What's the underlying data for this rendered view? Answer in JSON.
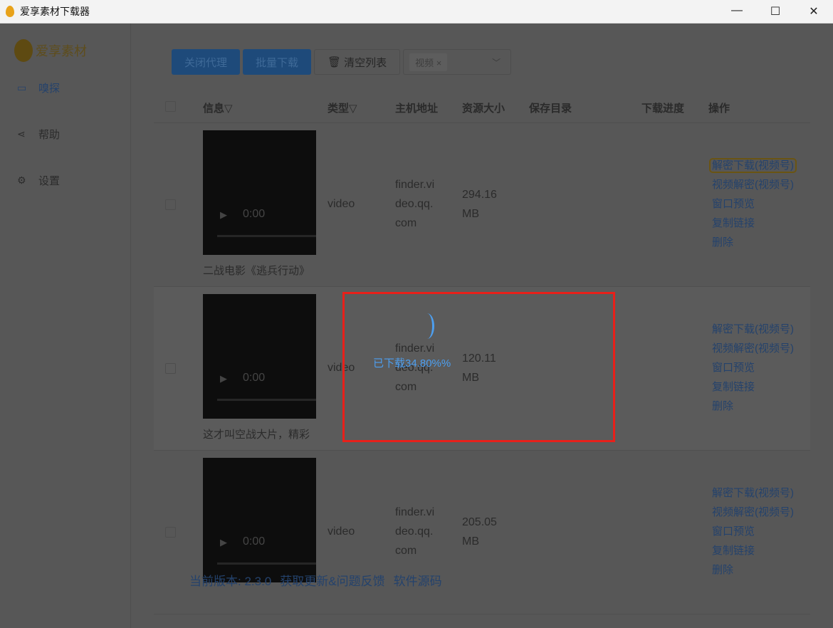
{
  "window": {
    "title": "爱享素材下载器",
    "controls": [
      "—",
      "☐",
      "✕"
    ]
  },
  "sidebar": {
    "brand": "爱享素材",
    "items": [
      {
        "label": "嗅探",
        "icon": "video-camera-icon"
      },
      {
        "label": "帮助",
        "icon": "share-icon"
      },
      {
        "label": "设置",
        "icon": "gear-icon"
      }
    ]
  },
  "toolbar": {
    "close_proxy": "关闭代理",
    "batch_download": "批量下载",
    "clear_list": "清空列表",
    "filter_tag": "视频",
    "filter_tag_close": "×"
  },
  "table": {
    "headers": [
      "信息",
      "类型",
      "主机地址",
      "资源大小",
      "保存目录",
      "下载进度",
      "操作"
    ],
    "rows": [
      {
        "time": "0:00",
        "caption": "二战电影《逃兵行动》",
        "type": "video",
        "host": [
          "finder.vi",
          "deo.qq.",
          "com"
        ],
        "size": [
          "294.16",
          "MB"
        ]
      },
      {
        "time": "0:00",
        "caption": "这才叫空战大片，精彩",
        "type": "video",
        "host": [
          "finder.vi",
          "deo.qq.",
          "com"
        ],
        "size": [
          "120.11",
          "MB"
        ]
      },
      {
        "time": "0:00",
        "caption": "",
        "type": "video",
        "host": [
          "finder.vi",
          "deo.qq.",
          "com"
        ],
        "size": [
          "205.05",
          "MB"
        ]
      }
    ],
    "actions": [
      "解密下载(视频号)",
      "视频解密(视频号)",
      "窗口预览",
      "复制链接",
      "删除"
    ]
  },
  "loading": {
    "text": "已下载34.80%%",
    "progress_percent": 34.8
  },
  "footer": {
    "version": "当前版本: 2.3.0",
    "feedback": "获取更新&问题反馈",
    "source": "软件源码"
  },
  "colors": {
    "accent": "#1e4a7a",
    "loading": "#4d9ff0",
    "highlight_box": "#e8201a"
  }
}
